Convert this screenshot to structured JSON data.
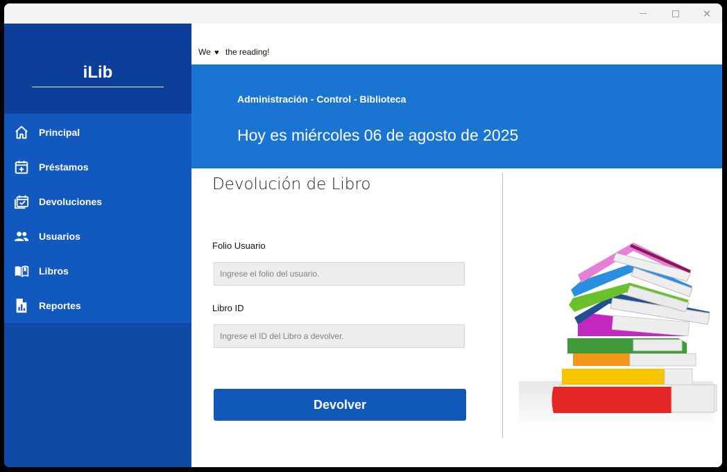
{
  "brand": {
    "title": "iLib"
  },
  "sidebar": {
    "items": [
      {
        "label": "Principal",
        "icon": "home-icon"
      },
      {
        "label": "Préstamos",
        "icon": "calendar-plus-icon"
      },
      {
        "label": "Devoluciones",
        "icon": "calendar-check-icon"
      },
      {
        "label": "Usuarios",
        "icon": "users-icon"
      },
      {
        "label": "Libros",
        "icon": "book-open-icon"
      },
      {
        "label": "Reportes",
        "icon": "report-icon"
      }
    ]
  },
  "header": {
    "tagline_pre": "We",
    "tagline_post": "the reading!",
    "subtitle": "Administración - Control - Biblioteca",
    "date": "Hoy es miércoles 06 de agosto de 2025"
  },
  "form": {
    "title": "Devolución de Libro",
    "folio_label": "Folio Usuario",
    "folio_placeholder": "Ingrese el folio del usuario.",
    "libro_label": "Libro ID",
    "libro_placeholder": "Ingrese el ID del Libro a devolver.",
    "submit_label": "Devolver"
  },
  "colors": {
    "sidebar": "#0f4aa6",
    "nav": "#1159bf",
    "hero": "#1a75d2",
    "button": "#1059b8"
  }
}
